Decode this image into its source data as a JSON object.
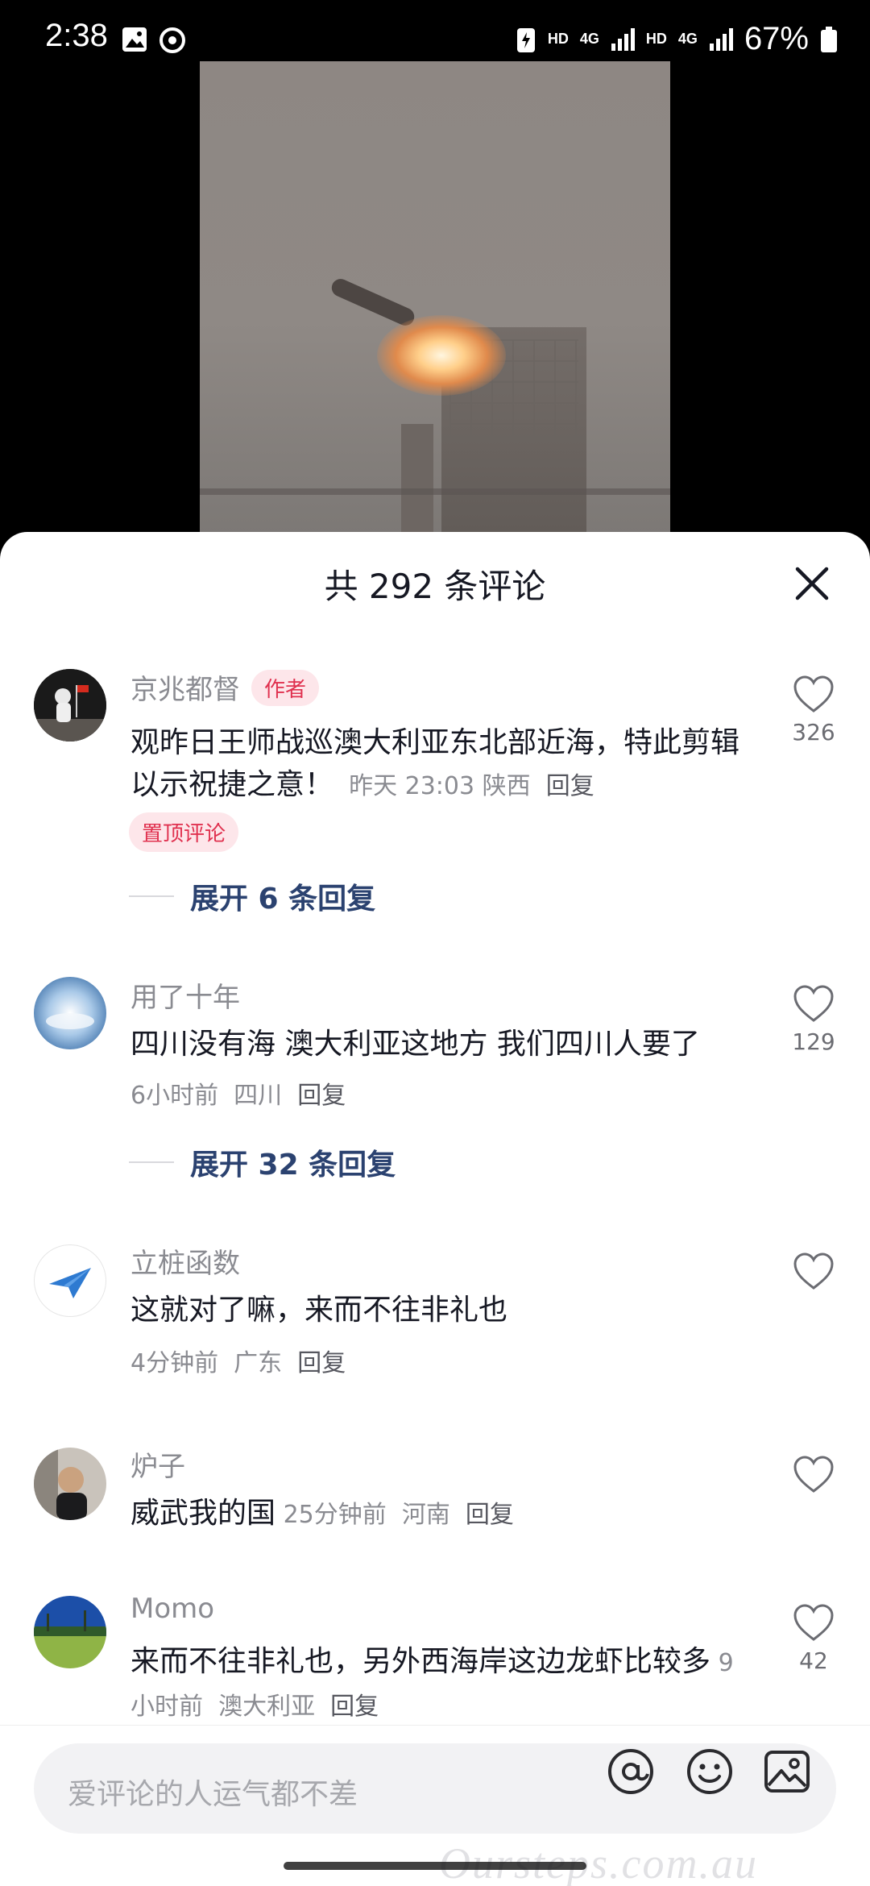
{
  "status_bar": {
    "time": "2:38",
    "hd1": "HD",
    "net1": "4G",
    "hd2": "HD",
    "net2": "4G",
    "battery": "67%"
  },
  "sheet": {
    "title": "共 292 条评论"
  },
  "comments": [
    {
      "username": "京兆都督",
      "author_tag": "作者",
      "text": "观昨日王师战巡澳大利亚东北部近海，特此剪辑以示祝捷之意！",
      "time": "昨天 23:03",
      "location": "陕西",
      "reply": "回复",
      "pinned_tag": "置顶评论",
      "likes": "326",
      "expand": "展开 6 条回复"
    },
    {
      "username": "用了十年",
      "text": "四川没有海  澳大利亚这地方 我们四川人要了",
      "time": "6小时前",
      "location": "四川",
      "reply": "回复",
      "likes": "129",
      "expand": "展开 32 条回复"
    },
    {
      "username": "立桩函数",
      "text": "这就对了嘛，来而不往非礼也",
      "time": "4分钟前",
      "location": "广东",
      "reply": "回复"
    },
    {
      "username": "炉子",
      "text": "威武我的国",
      "time": "25分钟前",
      "location": "河南",
      "reply": "回复"
    },
    {
      "username": "Momo",
      "text": "来而不往非礼也，另外西海岸这边龙虾比较多",
      "time": "9小时前",
      "location": "澳大利亚",
      "reply": "回复",
      "likes": "42"
    }
  ],
  "input_bar": {
    "placeholder": "爱评论的人运气都不差",
    "watermark": "Oursteps.com.au"
  },
  "colors": {
    "accent_red": "#e0314f",
    "expand_blue": "#2b4270",
    "meta_gray": "#8a8b91"
  }
}
